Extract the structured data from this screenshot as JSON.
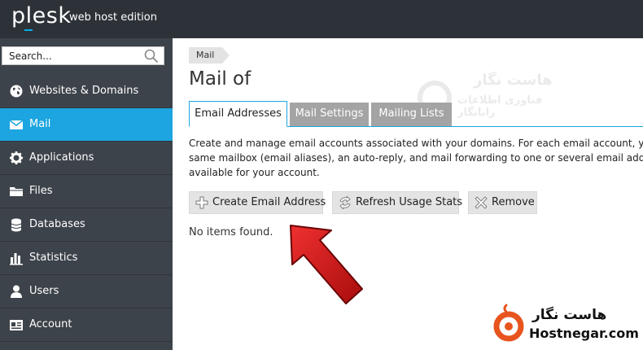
{
  "header": {
    "logo": "plesk",
    "edition": "web host edition"
  },
  "sidebar": {
    "search_placeholder": "Search...",
    "items": [
      {
        "label": "Websites & Domains",
        "icon": "globe-icon"
      },
      {
        "label": "Mail",
        "icon": "envelope-icon",
        "active": true
      },
      {
        "label": "Applications",
        "icon": "gear-icon"
      },
      {
        "label": "Files",
        "icon": "folder-icon"
      },
      {
        "label": "Databases",
        "icon": "database-icon"
      },
      {
        "label": "Statistics",
        "icon": "bar-chart-icon"
      },
      {
        "label": "Users",
        "icon": "user-icon"
      },
      {
        "label": "Account",
        "icon": "account-icon"
      }
    ]
  },
  "main": {
    "breadcrumb": "Mail",
    "title": "Mail of",
    "tabs": [
      {
        "label": "Email Addresses",
        "active": true
      },
      {
        "label": "Mail Settings"
      },
      {
        "label": "Mailing Lists"
      }
    ],
    "description_lines": [
      "Create and manage email accounts associated with your domains. For each email account, yo",
      "same mailbox (email aliases), an auto-reply, and mail forwarding to one or several email add",
      "available for your account."
    ],
    "toolbar": {
      "create_label": "Create Email Address",
      "refresh_label": "Refresh Usage Stats",
      "remove_label": "Remove"
    },
    "empty_text": "No items found."
  },
  "watermark": {
    "fa_line1": "هاست نگار",
    "fa_line2": "فناوری اطلاعات رایانگار"
  },
  "brand": {
    "fa": "هاست نگار",
    "en": "Hostnegar.com",
    "color": "#e8541e"
  },
  "colors": {
    "topbar": "#2d3238",
    "sidebar": "#3d434a",
    "active": "#1ca5e0",
    "arrow": "#d11a1a"
  }
}
